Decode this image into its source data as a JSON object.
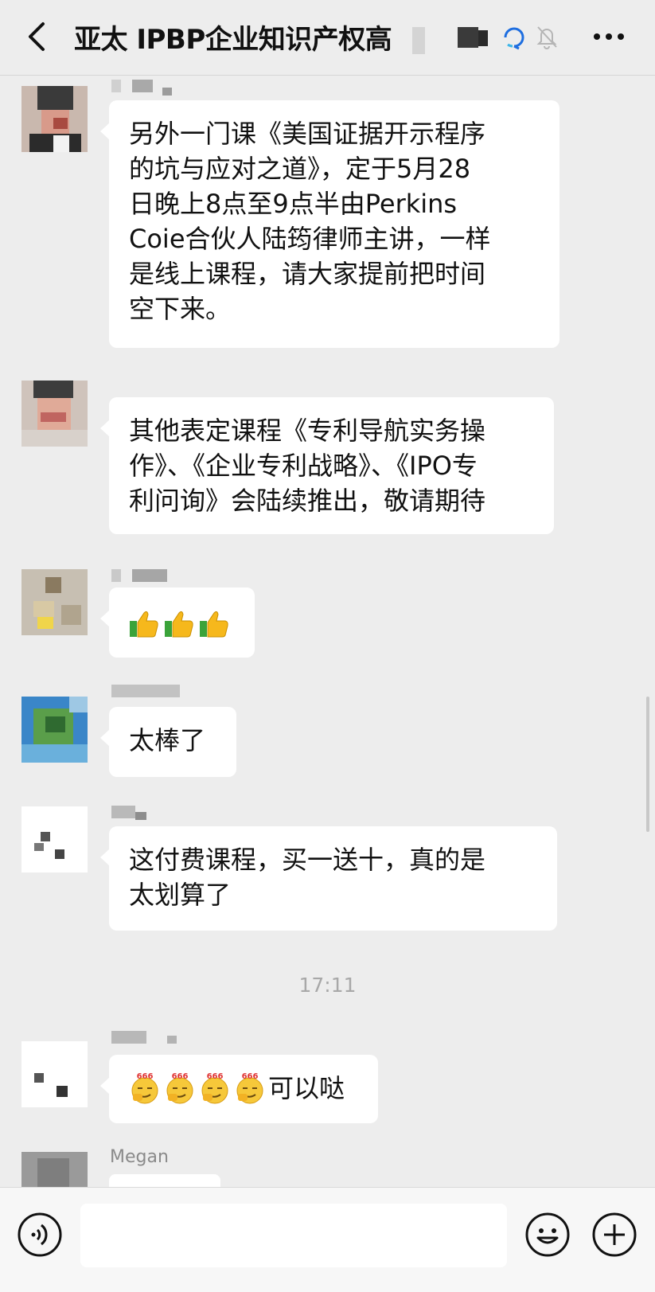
{
  "header": {
    "title": "亚太 IPBP企业知识产权高",
    "icons": [
      "back-arrow-icon",
      "loop-icon",
      "mute-bell-icon",
      "more-icon"
    ]
  },
  "messages": [
    {
      "type": "text",
      "lines": [
        "另外一门课《美国证据开示程序",
        "的坑与应对之道》，定于5月28",
        "日晚上8点至9点半由Perkins",
        "Coie合伙人陆筠律师主讲，一样",
        "是线上课程，请大家提前把时间",
        "空下来。"
      ]
    },
    {
      "type": "text",
      "lines": [
        "其他表定课程《专利导航实务操",
        "作》、《企业专利战略》、《IPO专",
        "利问询》会陆续推出，敬请期待"
      ]
    },
    {
      "type": "emoji",
      "emoji": "thumbs-up",
      "count": 3
    },
    {
      "type": "text",
      "lines": [
        "太棒了"
      ]
    },
    {
      "type": "text",
      "lines": [
        "这付费课程，买一送十，真的是",
        "太划算了"
      ]
    },
    {
      "type": "emoji-text",
      "emoji": "666-smirk",
      "count": 4,
      "text": "可以哒"
    },
    {
      "type": "partial",
      "sender": "Megan"
    }
  ],
  "timestamp": "17:11",
  "colors": {
    "background": "#ededed",
    "bubble": "#ffffff",
    "timestamp": "#a8a8a8",
    "emoji_yellow": "#f6b81c",
    "emoji_green": "#3aa33a"
  }
}
